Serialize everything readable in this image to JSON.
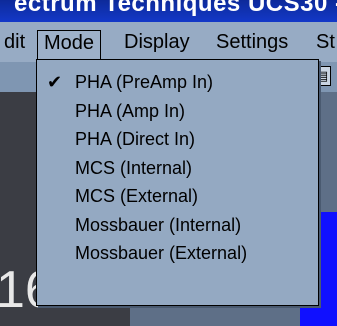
{
  "window": {
    "title": "ectrum Techniques UCS30 - "
  },
  "menubar": {
    "items": [
      {
        "label": "dit"
      },
      {
        "label": "Mode"
      },
      {
        "label": "Display"
      },
      {
        "label": "Settings"
      },
      {
        "label": "St"
      }
    ]
  },
  "mode_menu": {
    "checked_index": 0,
    "items": [
      {
        "label": "PHA (PreAmp In)",
        "checked": true
      },
      {
        "label": "PHA (Amp In)",
        "checked": false
      },
      {
        "label": "PHA (Direct In)",
        "checked": false
      },
      {
        "label": "MCS (Internal)",
        "checked": false
      },
      {
        "label": "MCS (External)",
        "checked": false
      },
      {
        "label": "Mossbauer (Internal)",
        "checked": false
      },
      {
        "label": "Mossbauer (External)",
        "checked": false
      }
    ]
  },
  "content": {
    "partial_number": "16"
  },
  "icons": {
    "check": "checkmark-icon",
    "toolbar": "toolbar-icon"
  },
  "colors": {
    "menu_bg": "#97abc4",
    "dropdown_bg": "#94a9c2",
    "title_bar": "#1338c8",
    "accent_blue": "#1010ff"
  }
}
